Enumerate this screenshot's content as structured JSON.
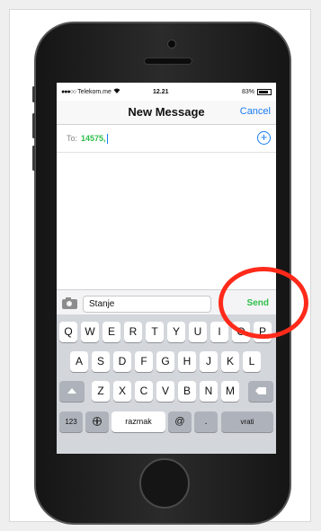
{
  "status_bar": {
    "signal_dots": "●●●○○",
    "carrier": "Telekom.me",
    "wifi_icon": "wifi-icon",
    "time": "12.21",
    "battery": "83%"
  },
  "nav": {
    "title": "New Message",
    "cancel_label": "Cancel"
  },
  "recipient": {
    "label": "To:",
    "value": "14575,",
    "add_icon": "plus-circle-icon"
  },
  "compose": {
    "camera_icon": "camera-icon",
    "message_text": "Stanje",
    "send_label": "Send"
  },
  "keyboard": {
    "row1": [
      "Q",
      "W",
      "E",
      "R",
      "T",
      "Y",
      "U",
      "I",
      "O",
      "P"
    ],
    "row2": [
      "A",
      "S",
      "D",
      "F",
      "G",
      "H",
      "J",
      "K",
      "L"
    ],
    "row3": [
      "Z",
      "X",
      "C",
      "V",
      "B",
      "N",
      "M"
    ],
    "shift_icon": "shift-icon",
    "delete_icon": "backspace-icon",
    "numbers_label": "123",
    "globe_icon": "globe-icon",
    "space_label": "razmak",
    "at_label": "@",
    "dot_label": ".",
    "return_label": "vrati"
  },
  "colors": {
    "accent_blue": "#1a7cf4",
    "send_green": "#2fbf4a",
    "highlight_red": "#ff2a1a"
  }
}
